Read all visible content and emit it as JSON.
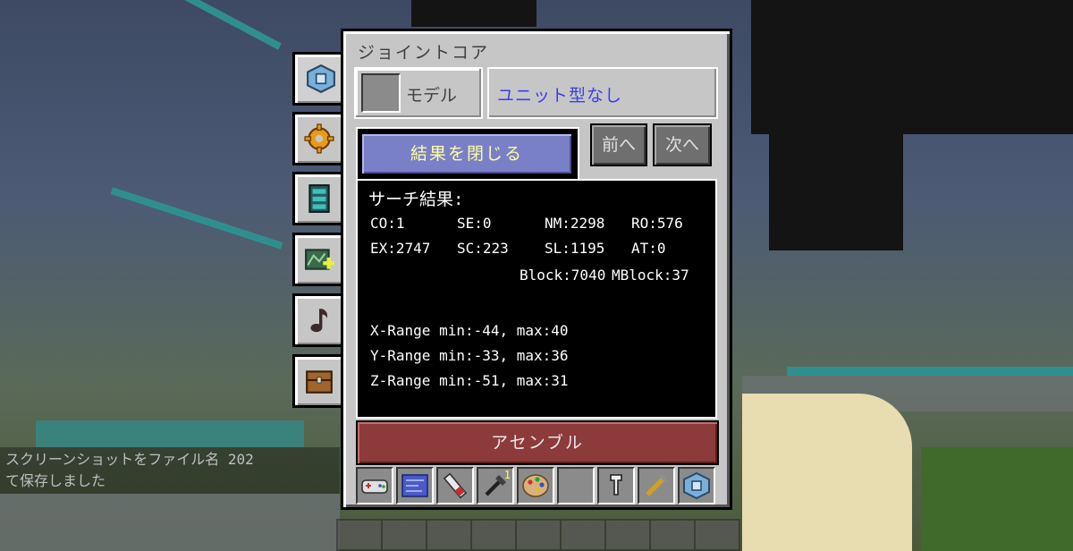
{
  "window": {
    "title": "ジョイントコア"
  },
  "model": {
    "label": "モデル",
    "unit_value": "ユニット型なし"
  },
  "buttons": {
    "prev": "前へ",
    "next": "次へ",
    "close_results": "結果を閉じる",
    "assemble": "アセンブル"
  },
  "results": {
    "heading": "サーチ結果:",
    "stats_row1": [
      "CO:1",
      "SE:0",
      "NM:2298",
      "RO:576"
    ],
    "stats_row2": [
      "EX:2747",
      "SC:223",
      "SL:1195",
      "AT:0"
    ],
    "blocks": "Block:7040",
    "mblocks": "MBlock:37",
    "x_range": "X-Range min:-44, max:40",
    "y_range": "Y-Range min:-33, max:36",
    "z_range": "Z-Range min:-51, max:31"
  },
  "chat": {
    "line1": "スクリーンショットをファイル名 202",
    "line2": "て保存しました"
  },
  "side_tabs": [
    "machine-block-icon",
    "gear-icon",
    "teal-cabinet-icon",
    "map-add-icon",
    "music-note-icon",
    "chest-icon"
  ],
  "toolbar": {
    "slots": [
      "controller-icon",
      "blueprint-icon",
      "wrench-tube-icon",
      "tool-icon",
      "palette-icon",
      "empty-slot",
      "hook-icon",
      "gold-tool-icon",
      "machine-block-icon"
    ],
    "tool_count": "1"
  },
  "colors": {
    "panel": "#c6c6c6",
    "close_button": "#7a80c8",
    "assemble_button": "#8c3a3a",
    "unit_text": "#3c3cf0"
  }
}
